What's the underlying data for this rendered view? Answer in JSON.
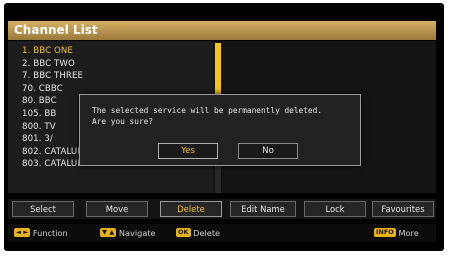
{
  "title": "Channel List",
  "channels": [
    "1. BBC ONE",
    "2. BBC TWO",
    "7. BBC THREE",
    "70. CBBC",
    "80. BBC",
    "105. BB",
    "800. TV",
    "801. 3/",
    "802. CATALUNYA RADIO",
    "803. CATALUNYA INFORMACIÓ"
  ],
  "selected_channel_index": 0,
  "dialog": {
    "message_line1": "The selected service will be permanently deleted.",
    "message_line2": "Are you sure?",
    "yes_label": "Yes",
    "no_label": "No"
  },
  "function_buttons": [
    {
      "label": "Select"
    },
    {
      "label": "Move"
    },
    {
      "label": "Delete"
    },
    {
      "label": "Edit Name"
    },
    {
      "label": "Lock"
    },
    {
      "label": "Favourites"
    }
  ],
  "active_function": "Delete",
  "help": {
    "function_text": "Function",
    "navigate_text": "Navigate",
    "ok_key": "OK",
    "delete_text": "Delete",
    "info_key": "INFO",
    "more_text": "More"
  },
  "colors": {
    "accent": "#f0c23c",
    "title_bar": "#c9a35a",
    "scrollbar": "#f3c619"
  },
  "scroll_position": 0.0
}
